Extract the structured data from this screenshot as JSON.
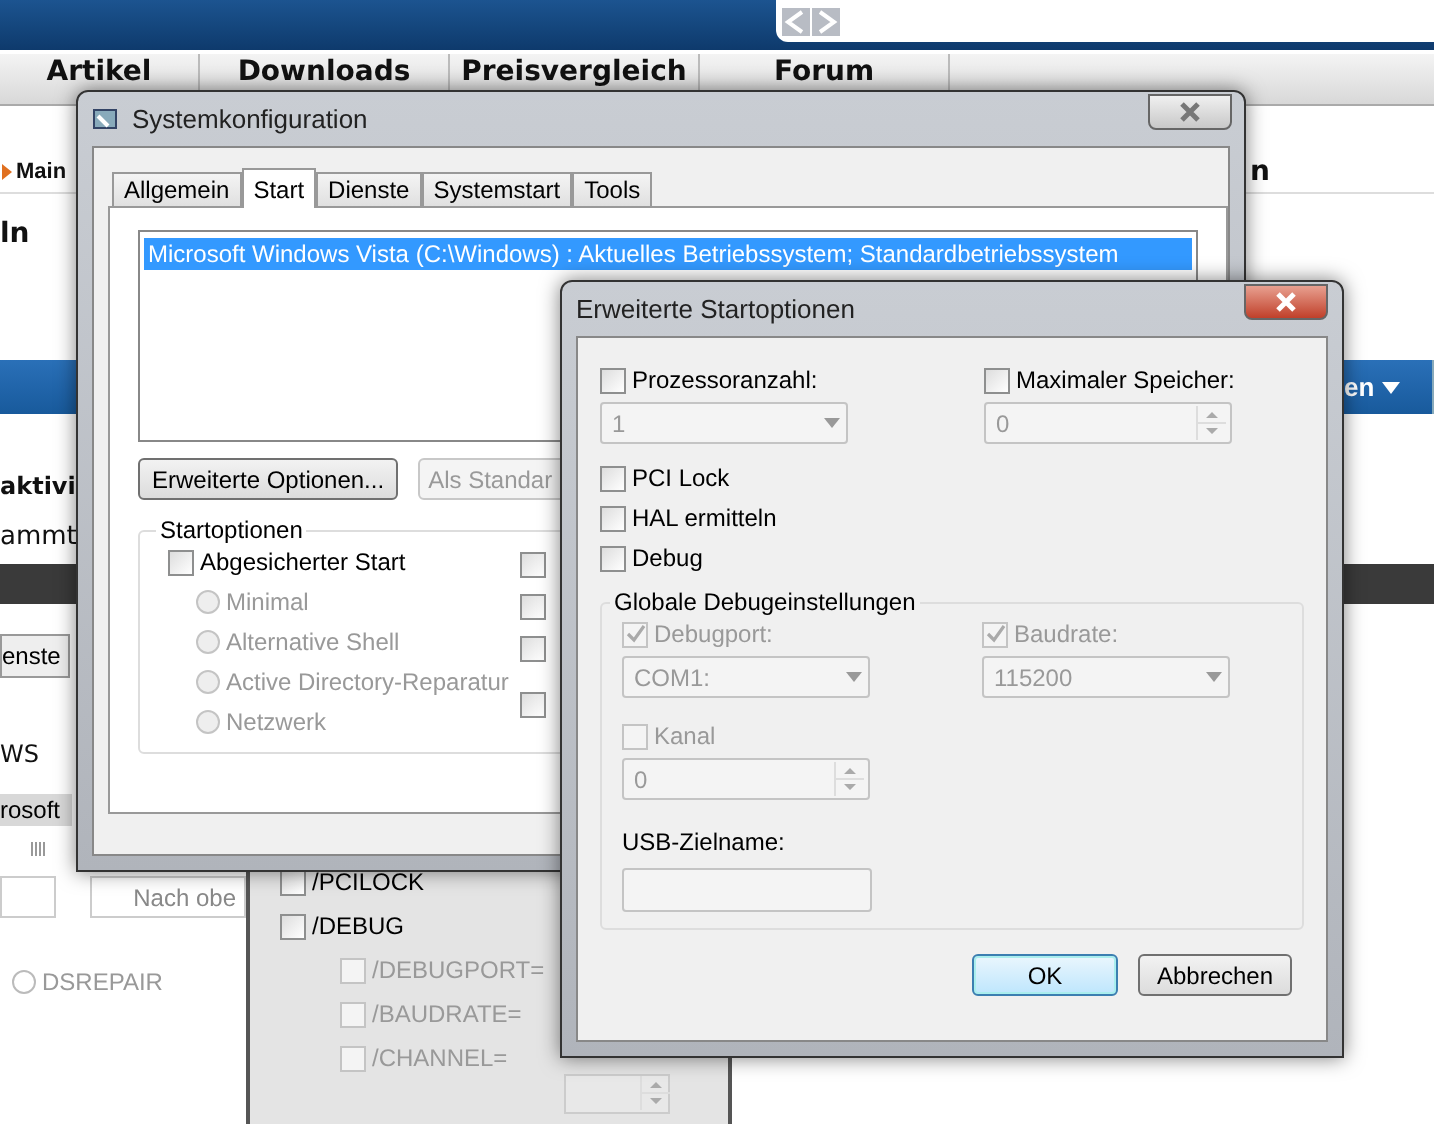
{
  "web_page": {
    "nav_tabs": [
      "Artikel",
      "Downloads",
      "Preisvergleich",
      "Forum"
    ],
    "breadcrumb": "Main",
    "right_heading": "n",
    "heading": "ln",
    "blue_bar_button": "en",
    "bold_line": "aktivi",
    "text_line": "ammt",
    "tab_fragment": "enste",
    "list_text": "WS",
    "selected_row": "rosoft",
    "button": "Nach obe",
    "radio": {
      "label": "DSREPAIR",
      "selected": false
    }
  },
  "boot_window": {
    "options": [
      {
        "label": "/PCILOCK",
        "checked": false,
        "disabled": false
      },
      {
        "label": "/DEBUG",
        "checked": false,
        "disabled": false
      },
      {
        "label": "/DEBUGPORT=",
        "checked": false,
        "disabled": true
      },
      {
        "label": "/BAUDRATE=",
        "checked": false,
        "disabled": true
      },
      {
        "label": "/CHANNEL=",
        "checked": false,
        "disabled": true
      }
    ]
  },
  "system_config": {
    "title": "Systemkonfiguration",
    "tabs": [
      {
        "label": "Allgemein",
        "selected": false
      },
      {
        "label": "Start",
        "selected": true
      },
      {
        "label": "Dienste",
        "selected": false
      },
      {
        "label": "Systemstart",
        "selected": false
      },
      {
        "label": "Tools",
        "selected": false
      }
    ],
    "boot_entries": [
      {
        "label": "Microsoft Windows Vista (C:\\Windows) : Aktuelles Betriebssystem; Standardbetriebssystem",
        "selected": true
      }
    ],
    "buttons": [
      {
        "label": "Erweiterte Optionen...",
        "disabled": false
      },
      {
        "label": "Als Standar",
        "disabled": true
      }
    ],
    "startoptions": {
      "title": "Startoptionen",
      "safe_boot": {
        "label": "Abgesicherter Start",
        "checked": false
      },
      "modes": [
        {
          "label": "Minimal",
          "selected": false,
          "disabled": true
        },
        {
          "label": "Alternative Shell",
          "selected": false,
          "disabled": true
        },
        {
          "label": "Active Directory-Reparatur",
          "selected": false,
          "disabled": true
        },
        {
          "label": "Netzwerk",
          "selected": false,
          "disabled": true
        }
      ],
      "side_checkboxes": [
        {
          "checked": false
        },
        {
          "checked": false
        },
        {
          "checked": false
        },
        {
          "checked": false
        }
      ]
    }
  },
  "advanced_dialog": {
    "title": "Erweiterte Startoptionen",
    "processor_count": {
      "label": "Prozessoranzahl:",
      "checked": false,
      "value": "1",
      "disabled": true
    },
    "max_memory": {
      "label": "Maximaler Speicher:",
      "checked": false,
      "value": "0",
      "disabled": true
    },
    "options": [
      {
        "label": "PCI Lock",
        "checked": false
      },
      {
        "label": "HAL ermitteln",
        "checked": false
      },
      {
        "label": "Debug",
        "checked": false
      }
    ],
    "debug_group": {
      "title": "Globale Debugeinstellungen",
      "debugport": {
        "label": "Debugport:",
        "checked": true,
        "disabled": true,
        "value": "COM1:"
      },
      "baudrate": {
        "label": "Baudrate:",
        "checked": true,
        "disabled": true,
        "value": "115200"
      },
      "channel": {
        "label": "Kanal",
        "checked": false,
        "disabled": true,
        "value": "0"
      },
      "usb_target": {
        "label": "USB-Zielname:",
        "disabled": true
      }
    },
    "buttons": [
      {
        "label": "OK",
        "default": true
      },
      {
        "label": "Abbrechen",
        "default": false
      }
    ]
  }
}
